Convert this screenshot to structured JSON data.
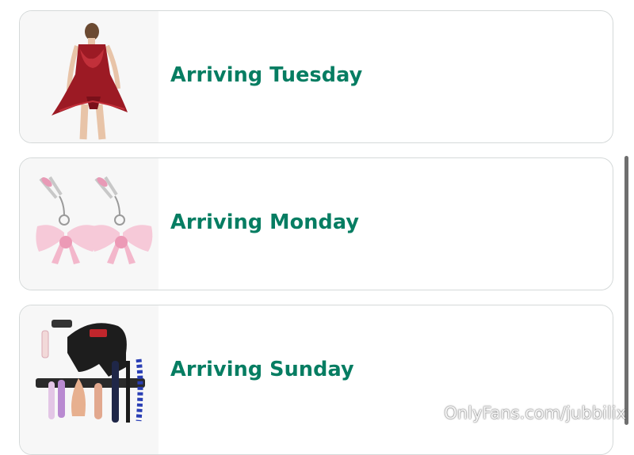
{
  "orders": [
    {
      "status": "Arriving Tuesday",
      "product_image": "red-lingerie-product-image"
    },
    {
      "status": "Arriving Monday",
      "product_image": "pink-bow-clamps-product-image"
    },
    {
      "status": "Arriving Sunday",
      "product_image": "machine-attachments-product-image"
    }
  ],
  "watermark": "OnlyFans.com/jubbilix",
  "colors": {
    "status_text": "#067d62",
    "card_border": "#d5d9d9",
    "thumb_bg": "#f7f7f7"
  }
}
